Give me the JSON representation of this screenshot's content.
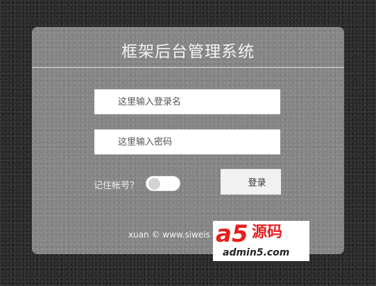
{
  "panel": {
    "title": "框架后台管理系统",
    "username_placeholder": "这里输入登录名",
    "password_placeholder": "这里输入密码",
    "remember_label": "记住帐号？",
    "remember_checked": false,
    "login_label": "登录",
    "footer": "xuan © www.siweis"
  },
  "watermark": {
    "brand": "a5",
    "brand_cn": "源码",
    "domain": "admin5.com",
    "color": "#e61f1f"
  }
}
